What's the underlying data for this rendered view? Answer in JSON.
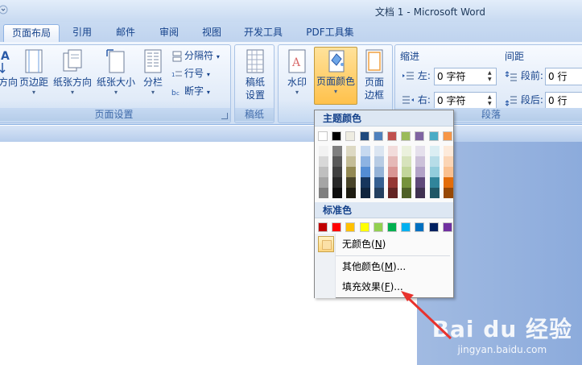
{
  "window": {
    "title_doc": "文档 1",
    "title_sep": "-",
    "title_app": "Microsoft Word"
  },
  "tabs": [
    {
      "label": "页面布局",
      "active": true
    },
    {
      "label": "引用"
    },
    {
      "label": "邮件"
    },
    {
      "label": "审阅"
    },
    {
      "label": "视图"
    },
    {
      "label": "开发工具"
    },
    {
      "label": "PDF工具集"
    }
  ],
  "page_setup": {
    "orientation_label": "方向",
    "margins_label": "页边距",
    "paper_orientation_label": "纸张方向",
    "paper_size_label": "纸张大小",
    "columns_label": "分栏",
    "breaks_label": "分隔符",
    "line_numbers_label": "行号",
    "hyphenation_label": "断字",
    "group_label": "页面设置"
  },
  "draft_paper": {
    "button_label_1": "稿纸",
    "button_label_2": "设置",
    "group_label": "稿纸"
  },
  "page_background": {
    "watermark_label": "水印",
    "page_color_label": "页面颜色",
    "page_border_label_1": "页面",
    "page_border_label_2": "边框"
  },
  "paragraph": {
    "indent_header": "缩进",
    "spacing_header": "间距",
    "left_label": "左:",
    "right_label": "右:",
    "left_value": "0 字符",
    "right_value": "0 字符",
    "before_label": "段前:",
    "after_label": "段后:",
    "before_value": "0 行",
    "after_value": "0 行",
    "group_label": "段落"
  },
  "dropdown": {
    "theme_header": "主题颜色",
    "standard_header": "标准色",
    "no_color": "无颜色(",
    "no_color_key": "N",
    "no_color_end": ")",
    "more_colors": "其他颜色(",
    "more_colors_key": "M",
    "more_colors_end": ")...",
    "fill_effects": "填充效果(",
    "fill_effects_key": "F",
    "fill_effects_end": ")...",
    "theme_top": [
      "#ffffff",
      "#000000",
      "#eeece1",
      "#1f497d",
      "#4f81bd",
      "#c0504d",
      "#9bbb59",
      "#8064a2",
      "#4bacc6",
      "#f79646"
    ],
    "theme_shades": [
      [
        "#f2f2f2",
        "#d8d8d8",
        "#bfbfbf",
        "#a5a5a5",
        "#7f7f7f"
      ],
      [
        "#7f7f7f",
        "#595959",
        "#3f3f3f",
        "#262626",
        "#0c0c0c"
      ],
      [
        "#ddd9c3",
        "#c4bd97",
        "#938953",
        "#494429",
        "#1d1b10"
      ],
      [
        "#c6d9f0",
        "#8db3e2",
        "#548dd4",
        "#17365d",
        "#0f243e"
      ],
      [
        "#dbe5f1",
        "#b8cce4",
        "#95b3d7",
        "#366092",
        "#244061"
      ],
      [
        "#f2dcdb",
        "#e5b9b7",
        "#d99694",
        "#953734",
        "#632423"
      ],
      [
        "#ebf1dd",
        "#d7e3bc",
        "#c3d69b",
        "#76923c",
        "#4f6128"
      ],
      [
        "#e5e0ec",
        "#ccc1d9",
        "#b2a2c7",
        "#5f497a",
        "#3f3151"
      ],
      [
        "#dbeef3",
        "#b7dde8",
        "#92cddc",
        "#31859b",
        "#205867"
      ],
      [
        "#fdeada",
        "#fbd5b5",
        "#fac08f",
        "#e36c09",
        "#974806"
      ]
    ],
    "standard": [
      "#c00000",
      "#ff0000",
      "#ffc000",
      "#ffff00",
      "#92d050",
      "#00b050",
      "#00b0f0",
      "#0070c0",
      "#002060",
      "#7030a0"
    ]
  },
  "watermark_site": {
    "brand": "Bai du 经验",
    "url": "jingyan.baidu.com"
  },
  "colors": {
    "accent": "#15428b",
    "arrow": "#e8322d"
  }
}
